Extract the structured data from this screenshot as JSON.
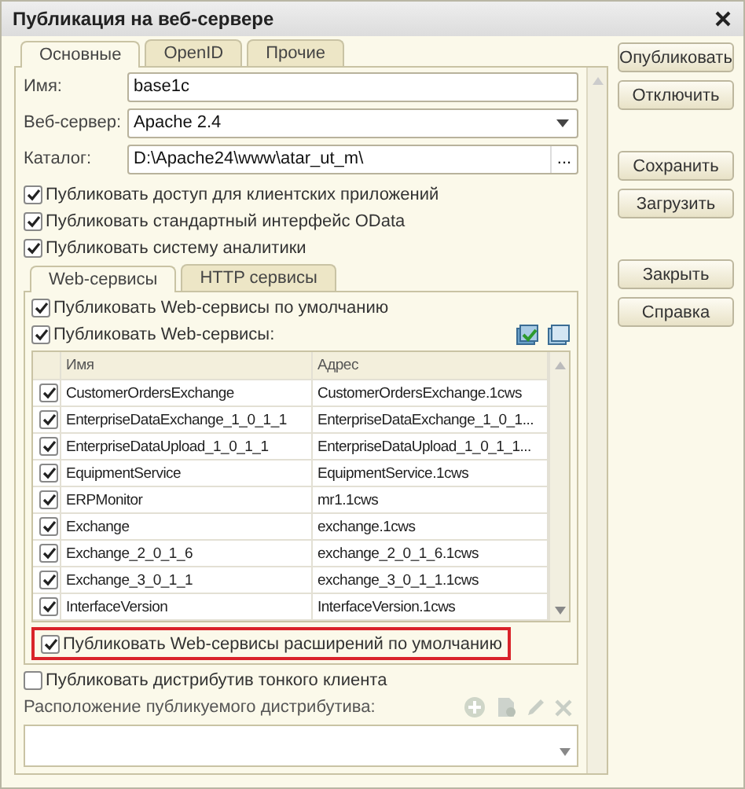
{
  "window": {
    "title": "Публикация на веб-сервере"
  },
  "tabs": [
    {
      "label": "Основные",
      "selected": true
    },
    {
      "label": "OpenID",
      "selected": false
    },
    {
      "label": "Прочие",
      "selected": false
    }
  ],
  "fields": [
    {
      "kind": "text",
      "label": "Имя:",
      "value": "base1c"
    },
    {
      "kind": "dropdown",
      "label": "Веб-сервер:",
      "value": "Apache 2.4"
    },
    {
      "kind": "browse",
      "label": "Каталог:",
      "value": "D:\\Apache24\\www\\atar_ut_m\\",
      "button": "..."
    }
  ],
  "options": [
    {
      "label": "Публиковать доступ для клиентских приложений",
      "checked": true
    },
    {
      "label": "Публиковать стандартный интерфейс OData",
      "checked": true
    },
    {
      "label": "Публиковать систему аналитики",
      "checked": true
    }
  ],
  "services_tabs": [
    {
      "label": "Web-сервисы",
      "selected": true
    },
    {
      "label": "HTTP сервисы",
      "selected": false
    }
  ],
  "services_options": [
    {
      "label": "Публиковать Web-сервисы по умолчанию",
      "checked": true
    },
    {
      "label": "Публиковать Web-сервисы:",
      "checked": true
    }
  ],
  "services_table": {
    "columns": [
      "Имя",
      "Адрес"
    ],
    "rows": [
      {
        "checked": true,
        "name": "CustomerOrdersExchange",
        "address": "CustomerOrdersExchange.1cws"
      },
      {
        "checked": true,
        "name": "EnterpriseDataExchange_1_0_1_1",
        "address": "EnterpriseDataExchange_1_0_1..."
      },
      {
        "checked": true,
        "name": "EnterpriseDataUpload_1_0_1_1",
        "address": "EnterpriseDataUpload_1_0_1_1..."
      },
      {
        "checked": true,
        "name": "EquipmentService",
        "address": "EquipmentService.1cws"
      },
      {
        "checked": true,
        "name": "ERPMonitor",
        "address": "mr1.1cws"
      },
      {
        "checked": true,
        "name": "Exchange",
        "address": "exchange.1cws"
      },
      {
        "checked": true,
        "name": "Exchange_2_0_1_6",
        "address": "exchange_2_0_1_6.1cws"
      },
      {
        "checked": true,
        "name": "Exchange_3_0_1_1",
        "address": "exchange_3_0_1_1.1cws"
      },
      {
        "checked": true,
        "name": "InterfaceVersion",
        "address": "InterfaceVersion.1cws"
      }
    ]
  },
  "extensions_option": {
    "label": "Публиковать Web-сервисы расширений по умолчанию",
    "checked": true,
    "highlighted": true
  },
  "thin_client_option": {
    "label": "Публиковать дистрибутив тонкого клиента",
    "checked": false
  },
  "distribution_location": {
    "label": "Расположение публикуемого дистрибутива:"
  },
  "button_groups": [
    [
      "Опубликовать",
      "Отключить"
    ],
    [
      "Сохранить",
      "Загрузить"
    ],
    [
      "Закрыть",
      "Справка"
    ]
  ]
}
